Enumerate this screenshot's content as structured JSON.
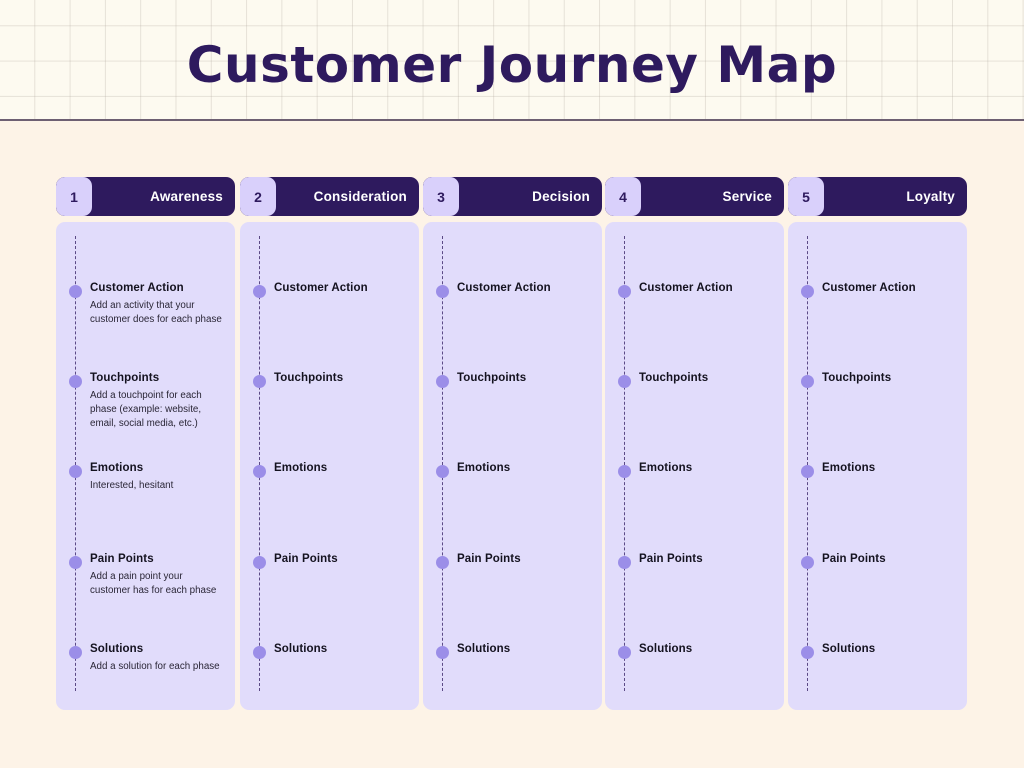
{
  "page": {
    "title": "Customer Journey Map",
    "background_color": "#fdf3e7",
    "banner_color": "#fdfaf0",
    "accent_dark": "#2e1a5e",
    "card_color": "#e1dcfb",
    "bullet_color": "#9b8ee8",
    "badge_color": "#d9d0fb"
  },
  "row_labels": {
    "customer_action": "Customer Action",
    "touchpoints": "Touchpoints",
    "emotions": "Emotions",
    "pain_points": "Pain Points",
    "solutions": "Solutions"
  },
  "columns": [
    {
      "number": "1",
      "title": "Awareness",
      "rows": [
        {
          "label": "Customer Action",
          "body": "Add an activity that your customer does for each phase"
        },
        {
          "label": "Touchpoints",
          "body": "Add a touchpoint for each phase (example: website, email, social media, etc.)"
        },
        {
          "label": "Emotions",
          "body": "Interested, hesitant"
        },
        {
          "label": "Pain Points",
          "body": "Add a pain point your customer has for each phase"
        },
        {
          "label": "Solutions",
          "body": "Add a solution for each phase"
        }
      ]
    },
    {
      "number": "2",
      "title": "Consideration",
      "rows": [
        {
          "label": "Customer Action",
          "body": ""
        },
        {
          "label": "Touchpoints",
          "body": ""
        },
        {
          "label": "Emotions",
          "body": ""
        },
        {
          "label": "Pain Points",
          "body": ""
        },
        {
          "label": "Solutions",
          "body": ""
        }
      ]
    },
    {
      "number": "3",
      "title": "Decision",
      "rows": [
        {
          "label": "Customer Action",
          "body": ""
        },
        {
          "label": "Touchpoints",
          "body": ""
        },
        {
          "label": "Emotions",
          "body": ""
        },
        {
          "label": "Pain Points",
          "body": ""
        },
        {
          "label": "Solutions",
          "body": ""
        }
      ]
    },
    {
      "number": "4",
      "title": "Service",
      "rows": [
        {
          "label": "Customer Action",
          "body": ""
        },
        {
          "label": "Touchpoints",
          "body": ""
        },
        {
          "label": "Emotions",
          "body": ""
        },
        {
          "label": "Pain Points",
          "body": ""
        },
        {
          "label": "Solutions",
          "body": ""
        }
      ]
    },
    {
      "number": "5",
      "title": "Loyalty",
      "rows": [
        {
          "label": "Customer Action",
          "body": ""
        },
        {
          "label": "Touchpoints",
          "body": ""
        },
        {
          "label": "Emotions",
          "body": ""
        },
        {
          "label": "Pain Points",
          "body": ""
        },
        {
          "label": "Solutions",
          "body": ""
        }
      ]
    }
  ]
}
